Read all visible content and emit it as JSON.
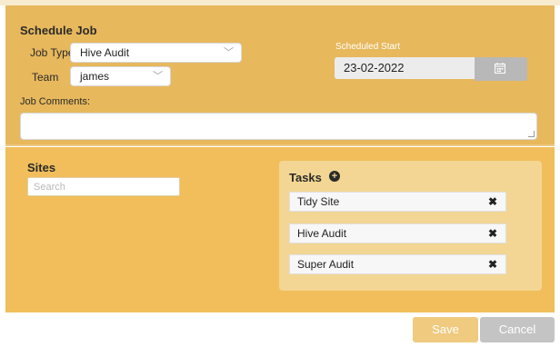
{
  "schedule": {
    "title": "Schedule Job",
    "job_type_label": "Job Type",
    "job_type_value": "Hive Audit",
    "team_label": "Team",
    "team_value": "james",
    "scheduled_start_label": "Scheduled Start",
    "scheduled_start_value": "23-02-2022",
    "comments_label": "Job Comments:"
  },
  "sites": {
    "title": "Sites",
    "search_placeholder": "Search"
  },
  "tasks": {
    "title": "Tasks",
    "items": [
      {
        "label": "Tidy Site"
      },
      {
        "label": "Hive Audit"
      },
      {
        "label": "Super Audit"
      }
    ]
  },
  "footer": {
    "save_label": "Save",
    "cancel_label": "Cancel"
  },
  "colors": {
    "header_bg": "#e7b85c",
    "body_bg": "#f1be5b",
    "tasks_panel_bg": "#f3d693"
  }
}
